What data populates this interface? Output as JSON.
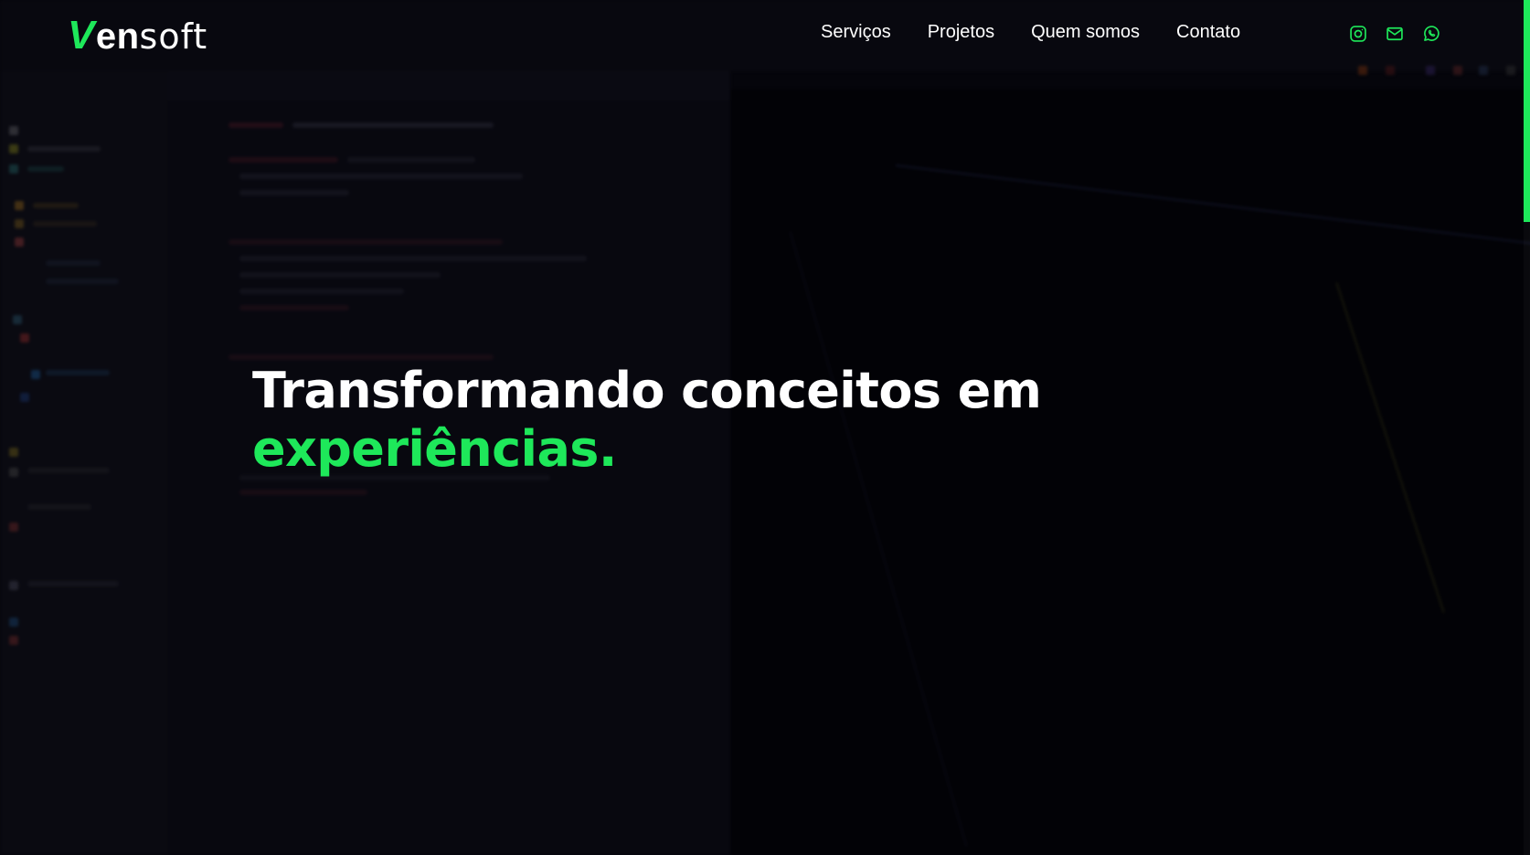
{
  "brand": {
    "logo_v": "V",
    "logo_en": "en",
    "logo_soft": "soft",
    "accent_color": "#1ee85a"
  },
  "nav": {
    "items": [
      {
        "label": "Serviços"
      },
      {
        "label": "Projetos"
      },
      {
        "label": "Quem somos"
      },
      {
        "label": "Contato"
      }
    ]
  },
  "social": [
    {
      "icon": "instagram-icon"
    },
    {
      "icon": "mail-icon"
    },
    {
      "icon": "whatsapp-icon"
    }
  ],
  "hero": {
    "headline": "Transformando conceitos em",
    "headline_accent": "experiências."
  },
  "scroll": {
    "progress": 0.26,
    "color": "#1ee85a"
  }
}
